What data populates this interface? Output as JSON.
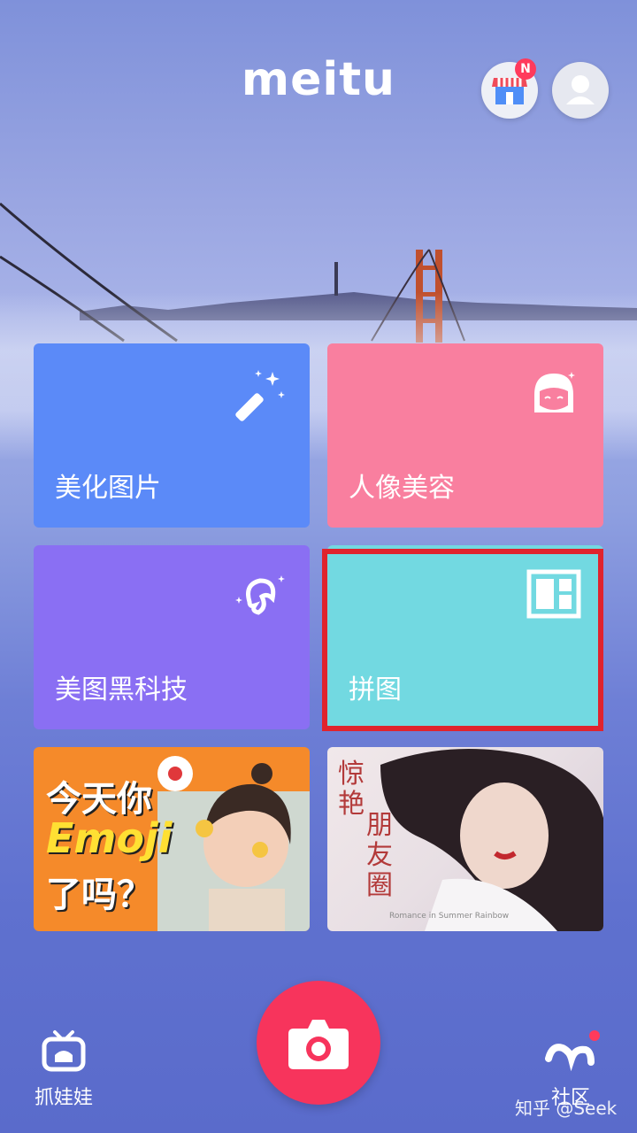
{
  "header": {
    "logo": "meitu",
    "store_badge": "N"
  },
  "tiles": [
    {
      "label": "美化图片",
      "icon": "magic-wand-icon",
      "color": "#5b8af8"
    },
    {
      "label": "人像美容",
      "icon": "face-icon",
      "color": "#f97f9f"
    },
    {
      "label": "美图黑科技",
      "icon": "hair-sparkle-icon",
      "color": "#8a6ff3"
    },
    {
      "label": "拼图",
      "icon": "collage-icon",
      "color": "#72d9e1"
    }
  ],
  "banners": [
    {
      "line1": "今天你",
      "line2": "Emoji",
      "line3": "了吗？"
    },
    {
      "line1": "惊艳",
      "line2": "朋友圈",
      "caption": "Romance in Summer Rainbow"
    }
  ],
  "bottom_nav": {
    "catch_label": "抓娃娃",
    "community_label": "社区",
    "watermark": "知乎 @Seek"
  },
  "highlight_color": "#e0232d"
}
